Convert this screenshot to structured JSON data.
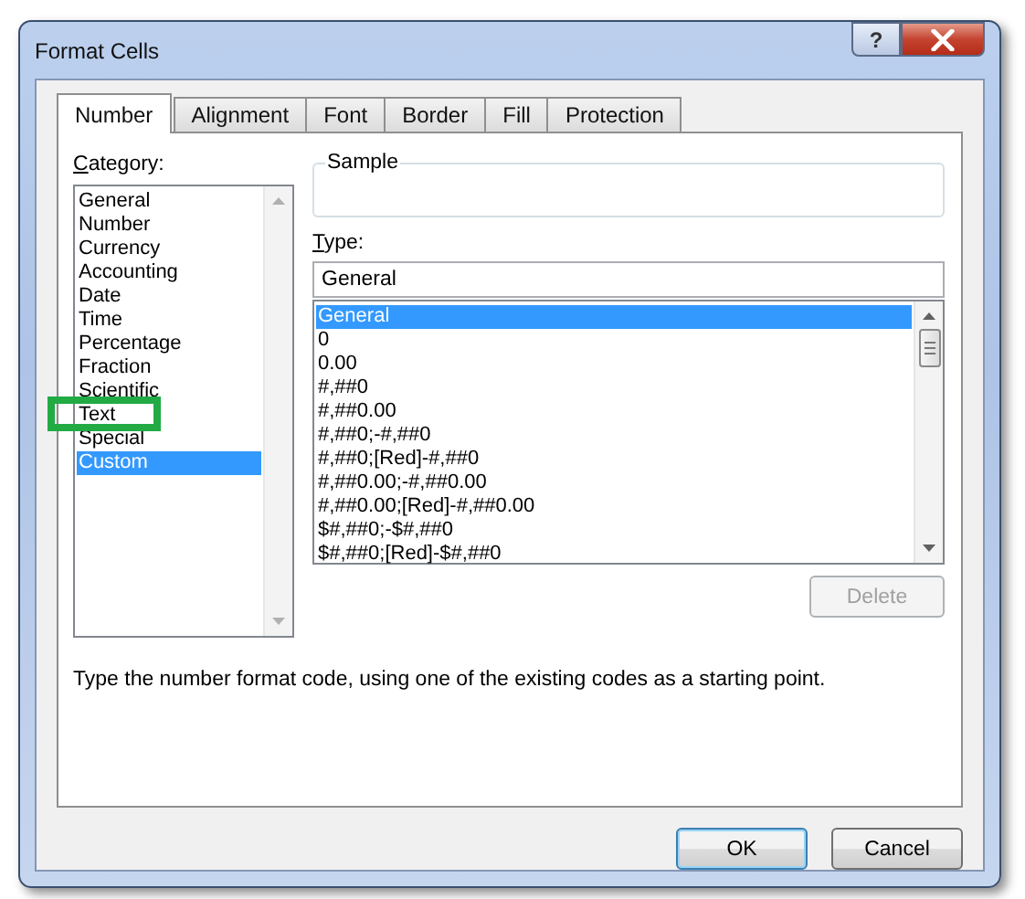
{
  "window": {
    "title": "Format Cells",
    "help_button": "?"
  },
  "tabs": [
    {
      "label": "Number",
      "selected": true
    },
    {
      "label": "Alignment",
      "selected": false
    },
    {
      "label": "Font",
      "selected": false
    },
    {
      "label": "Border",
      "selected": false
    },
    {
      "label": "Fill",
      "selected": false
    },
    {
      "label": "Protection",
      "selected": false
    }
  ],
  "category": {
    "label": "Category:",
    "items": [
      {
        "label": "General",
        "selected": false,
        "annotated": false
      },
      {
        "label": "Number",
        "selected": false,
        "annotated": false
      },
      {
        "label": "Currency",
        "selected": false,
        "annotated": false
      },
      {
        "label": "Accounting",
        "selected": false,
        "annotated": false
      },
      {
        "label": "Date",
        "selected": false,
        "annotated": false
      },
      {
        "label": "Time",
        "selected": false,
        "annotated": false
      },
      {
        "label": "Percentage",
        "selected": false,
        "annotated": false
      },
      {
        "label": "Fraction",
        "selected": false,
        "annotated": false
      },
      {
        "label": "Scientific",
        "selected": false,
        "annotated": false
      },
      {
        "label": "Text",
        "selected": false,
        "annotated": true
      },
      {
        "label": "Special",
        "selected": false,
        "annotated": false
      },
      {
        "label": "Custom",
        "selected": true,
        "annotated": false
      }
    ]
  },
  "sample": {
    "label": "Sample"
  },
  "type": {
    "label": "Type:",
    "value": "General",
    "items": [
      {
        "label": "General",
        "selected": true
      },
      {
        "label": "0",
        "selected": false
      },
      {
        "label": "0.00",
        "selected": false
      },
      {
        "label": "#,##0",
        "selected": false
      },
      {
        "label": "#,##0.00",
        "selected": false
      },
      {
        "label": "#,##0;-#,##0",
        "selected": false
      },
      {
        "label": "#,##0;[Red]-#,##0",
        "selected": false
      },
      {
        "label": "#,##0.00;-#,##0.00",
        "selected": false
      },
      {
        "label": "#,##0.00;[Red]-#,##0.00",
        "selected": false
      },
      {
        "label": "$#,##0;-$#,##0",
        "selected": false
      },
      {
        "label": "$#,##0;[Red]-$#,##0",
        "selected": false
      }
    ]
  },
  "delete_button": {
    "label": "Delete",
    "disabled": true
  },
  "description": "Type the number format code, using one of the existing codes as a starting point.",
  "buttons": [
    {
      "label": "OK",
      "default": true
    },
    {
      "label": "Cancel",
      "default": false
    }
  ]
}
